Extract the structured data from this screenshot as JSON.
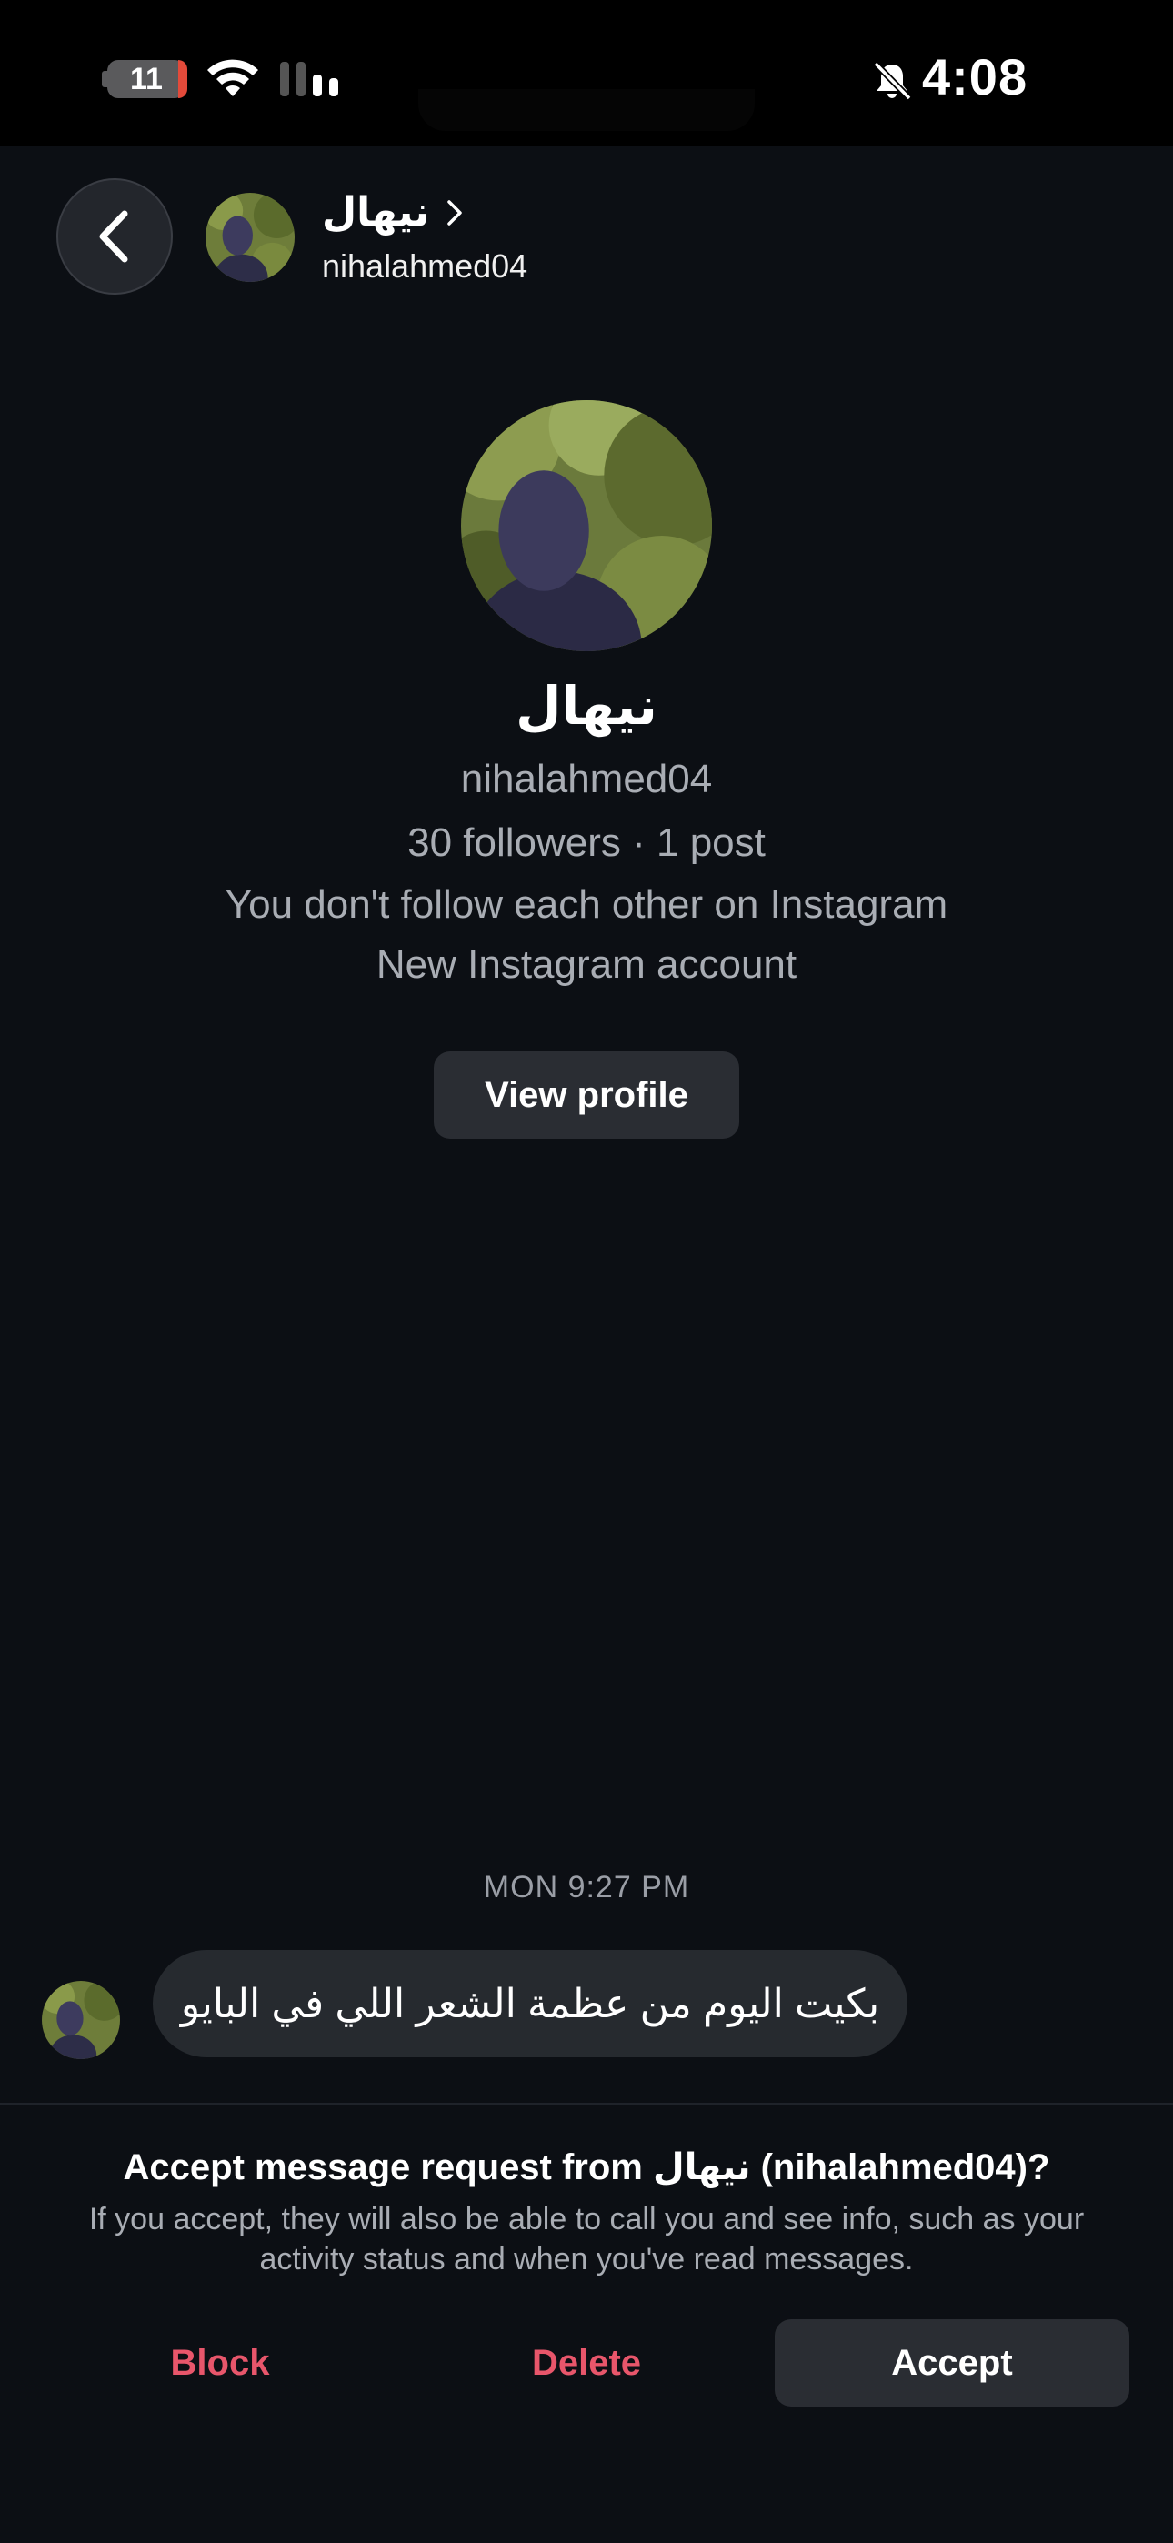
{
  "status_bar": {
    "battery": "11",
    "time": "4:08"
  },
  "header": {
    "name": "نيهال",
    "username": "nihalahmed04"
  },
  "profile": {
    "name": "نيهال",
    "username": "nihalahmed04",
    "stats": "30 followers · 1 post",
    "follow_status": "You don't follow each other on Instagram",
    "account_note": "New Instagram account",
    "view_profile_label": "View profile"
  },
  "conversation": {
    "timestamp": "MON 9:27 PM",
    "message": "بكيت اليوم من عظمة الشعر اللي في البايو"
  },
  "request": {
    "title": "Accept message request from نيهال (nihalahmed04)?",
    "description": "If you accept, they will also be able to call you and see info, such as your activity status and when you've read messages.",
    "block_label": "Block",
    "delete_label": "Delete",
    "accept_label": "Accept"
  },
  "colors": {
    "background": "#0c0f14",
    "danger": "#e8566b",
    "button": "#2a2d33"
  }
}
